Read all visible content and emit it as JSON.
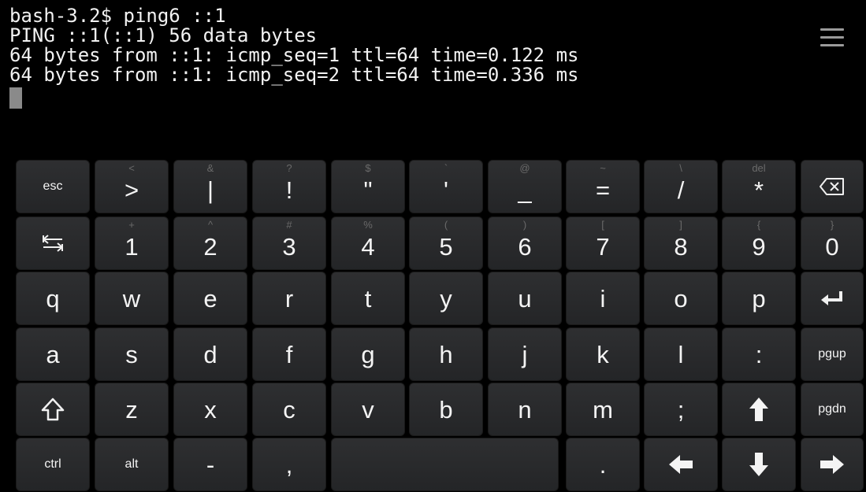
{
  "terminal": {
    "lines": [
      "bash-3.2$ ping6 ::1",
      "PING ::1(::1) 56 data bytes",
      "64 bytes from ::1: icmp_seq=1 ttl=64 time=0.122 ms",
      "64 bytes from ::1: icmp_seq=2 ttl=64 time=0.336 ms"
    ],
    "menu_icon": "menu-icon"
  },
  "keyboard": {
    "rows": [
      [
        {
          "label": "esc",
          "alt": ""
        },
        {
          "label": ">",
          "alt": "<"
        },
        {
          "label": "|",
          "alt": "&"
        },
        {
          "label": "!",
          "alt": "?"
        },
        {
          "label": "\"",
          "alt": "$"
        },
        {
          "label": "'",
          "alt": "`"
        },
        {
          "label": "_",
          "alt": "@"
        },
        {
          "label": "=",
          "alt": "~"
        },
        {
          "label": "/",
          "alt": "\\"
        },
        {
          "label": "*",
          "alt": "del"
        },
        {
          "label": "",
          "alt": "",
          "icon": "backspace-icon"
        }
      ],
      [
        {
          "label": "",
          "alt": "",
          "icon": "tab-icon"
        },
        {
          "label": "1",
          "alt": "+"
        },
        {
          "label": "2",
          "alt": "^"
        },
        {
          "label": "3",
          "alt": "#"
        },
        {
          "label": "4",
          "alt": "%"
        },
        {
          "label": "5",
          "alt": "("
        },
        {
          "label": "6",
          "alt": ")"
        },
        {
          "label": "7",
          "alt": "["
        },
        {
          "label": "8",
          "alt": "]"
        },
        {
          "label": "9",
          "alt": "{"
        },
        {
          "label": "0",
          "alt": "}"
        }
      ],
      [
        {
          "label": "q",
          "alt": ""
        },
        {
          "label": "w",
          "alt": ""
        },
        {
          "label": "e",
          "alt": ""
        },
        {
          "label": "r",
          "alt": ""
        },
        {
          "label": "t",
          "alt": ""
        },
        {
          "label": "y",
          "alt": ""
        },
        {
          "label": "u",
          "alt": ""
        },
        {
          "label": "i",
          "alt": ""
        },
        {
          "label": "o",
          "alt": ""
        },
        {
          "label": "p",
          "alt": ""
        },
        {
          "label": "",
          "alt": "",
          "icon": "enter-icon"
        }
      ],
      [
        {
          "label": "a",
          "alt": ""
        },
        {
          "label": "s",
          "alt": ""
        },
        {
          "label": "d",
          "alt": ""
        },
        {
          "label": "f",
          "alt": ""
        },
        {
          "label": "g",
          "alt": ""
        },
        {
          "label": "h",
          "alt": ""
        },
        {
          "label": "j",
          "alt": ""
        },
        {
          "label": "k",
          "alt": ""
        },
        {
          "label": "l",
          "alt": ""
        },
        {
          "label": ":",
          "alt": ""
        },
        {
          "label": "pgup",
          "alt": ""
        }
      ],
      [
        {
          "label": "",
          "alt": "",
          "icon": "shift-icon"
        },
        {
          "label": "z",
          "alt": ""
        },
        {
          "label": "x",
          "alt": ""
        },
        {
          "label": "c",
          "alt": ""
        },
        {
          "label": "v",
          "alt": ""
        },
        {
          "label": "b",
          "alt": ""
        },
        {
          "label": "n",
          "alt": ""
        },
        {
          "label": "m",
          "alt": ""
        },
        {
          "label": ";",
          "alt": ""
        },
        {
          "label": "",
          "alt": "",
          "icon": "arrow-up-icon"
        },
        {
          "label": "pgdn",
          "alt": ""
        }
      ],
      [
        {
          "label": "ctrl",
          "alt": ""
        },
        {
          "label": "alt",
          "alt": ""
        },
        {
          "label": "-",
          "alt": ""
        },
        {
          "label": ",",
          "alt": ""
        },
        {
          "label": "",
          "alt": "",
          "name": "space"
        },
        {
          "label": ".",
          "alt": ""
        },
        {
          "label": "",
          "alt": "",
          "icon": "arrow-left-icon"
        },
        {
          "label": "",
          "alt": "",
          "icon": "arrow-down-icon"
        },
        {
          "label": "",
          "alt": "",
          "icon": "arrow-right-icon"
        }
      ]
    ]
  }
}
